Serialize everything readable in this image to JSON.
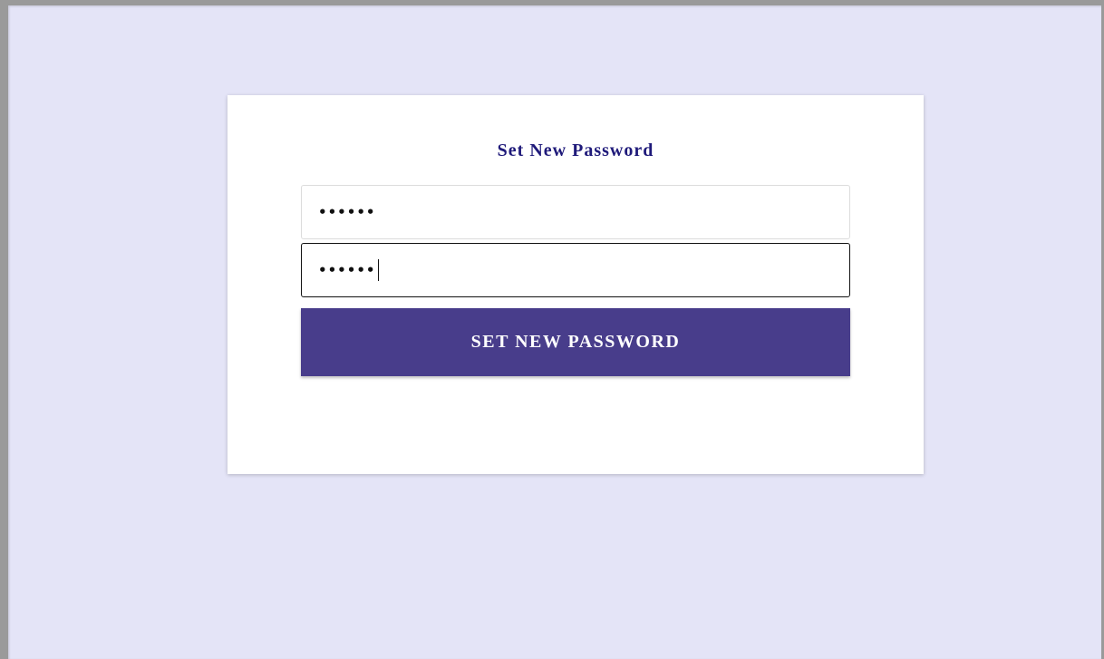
{
  "form": {
    "title": "Set New Password",
    "new_password": {
      "value_masked": "••••••"
    },
    "confirm_password": {
      "value_masked": "••••••"
    },
    "submit_label": "SET NEW PASSWORD"
  },
  "colors": {
    "page_background": "#e4e4f7",
    "card_background": "#ffffff",
    "title_color": "#1f1a7a",
    "button_background": "#483d8b",
    "button_text": "#ffffff"
  }
}
